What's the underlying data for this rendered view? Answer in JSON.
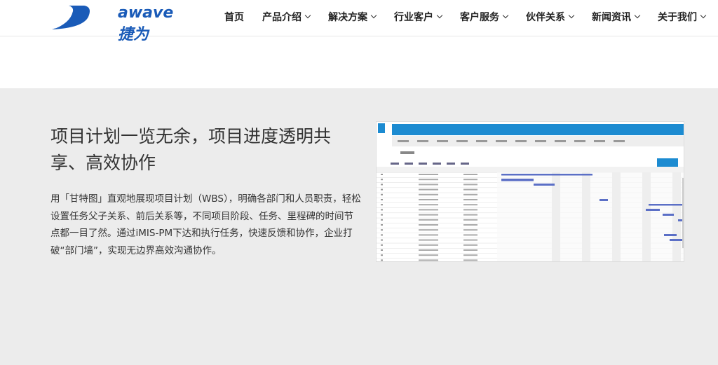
{
  "header": {
    "logo": {
      "text": "awave",
      "cn": "捷为",
      "brand_color": "#1a5bb8"
    },
    "nav": [
      {
        "label": "首页",
        "has_dropdown": false
      },
      {
        "label": "产品介绍",
        "has_dropdown": true
      },
      {
        "label": "解决方案",
        "has_dropdown": true
      },
      {
        "label": "行业客户",
        "has_dropdown": true
      },
      {
        "label": "客户服务",
        "has_dropdown": true
      },
      {
        "label": "伙伴关系",
        "has_dropdown": true
      },
      {
        "label": "新闻资讯",
        "has_dropdown": true
      },
      {
        "label": "关于我们",
        "has_dropdown": true
      }
    ]
  },
  "feature": {
    "title": "项目计划一览无余，项目进度透明共享、高效协作",
    "description": "用「甘特图」直观地展现项目计划（WBS），明确各部门和人员职责，轻松设置任务父子关系、前后关系等，不同项目阶段、任务、里程碑的时间节点都一目了然。通过iMIS-PM下达和执行任务，快速反馈和协作，企业打破“部门墙”，实现无边界高效沟通协作。",
    "screenshot": {
      "type": "gantt-chart-screenshot",
      "accent": "#1c8bd1",
      "bar_color": "#5b6fc6"
    }
  }
}
